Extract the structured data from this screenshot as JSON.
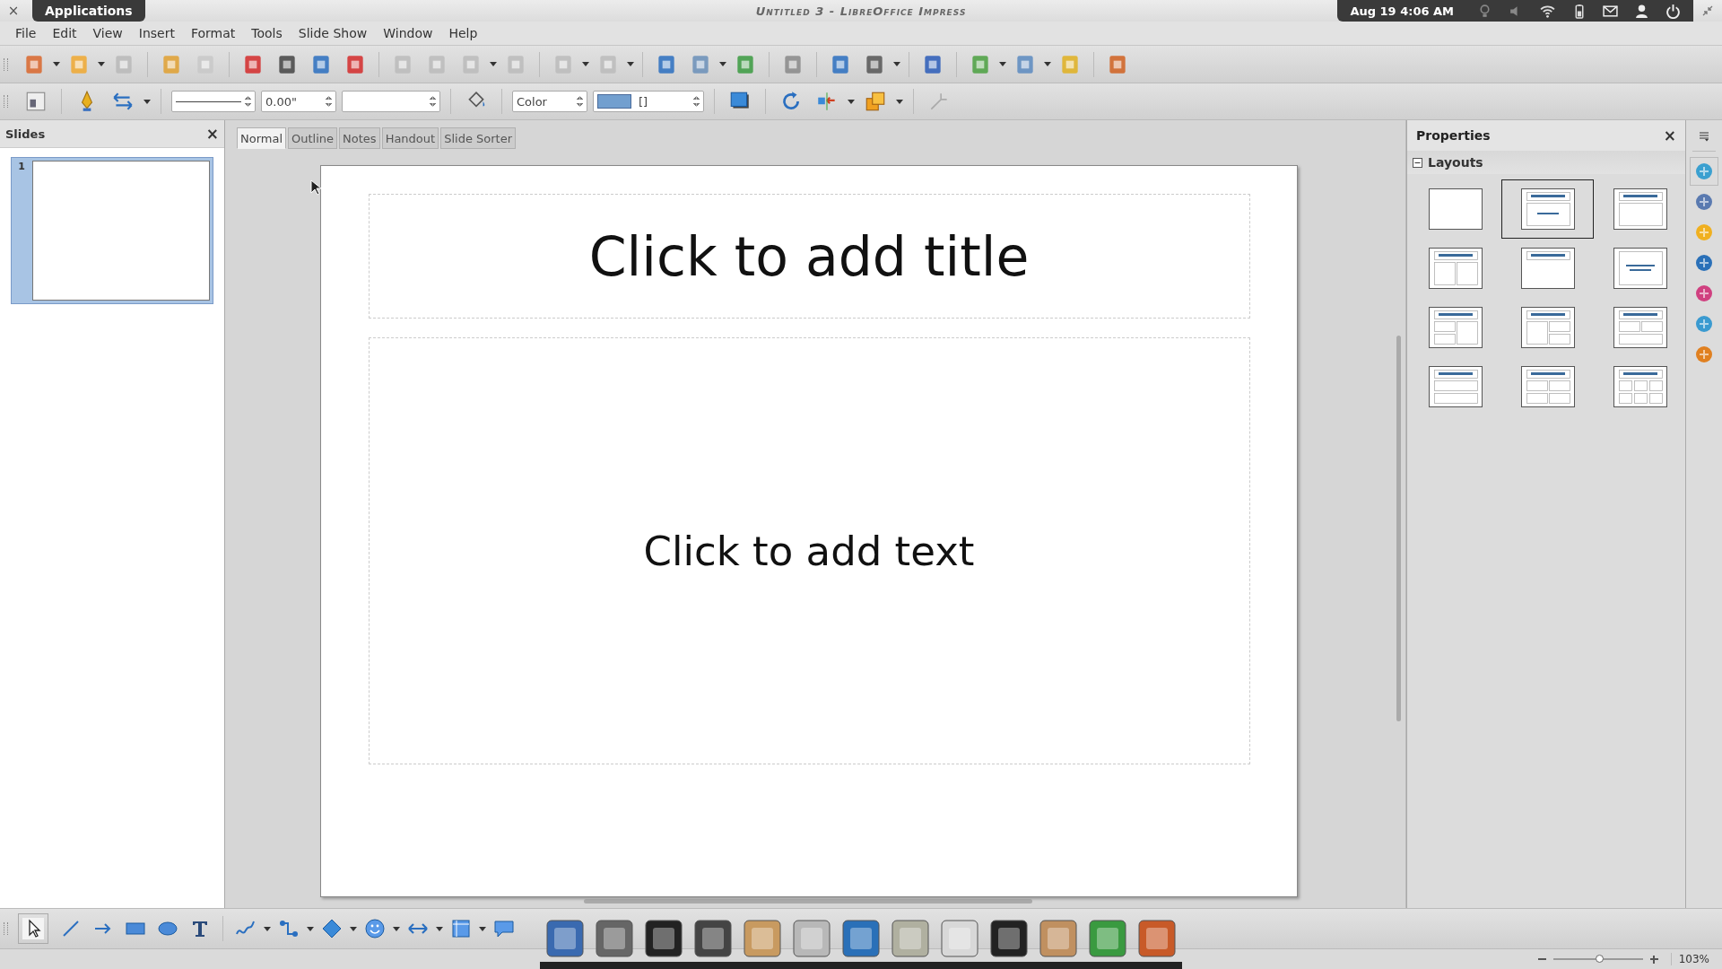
{
  "top_bar": {
    "close": "×",
    "app_tab": "Applications",
    "window_title": "Untitled 3 - LibreOffice Impress",
    "clock": "Aug 19  4:06 AM"
  },
  "menu": [
    "File",
    "Edit",
    "View",
    "Insert",
    "Format",
    "Tools",
    "Slide Show",
    "Window",
    "Help"
  ],
  "line_toolbar": {
    "line_width": "0.00\"",
    "area_style": "Color",
    "fill_color": "[]"
  },
  "slides_pane": {
    "title": "Slides",
    "close": "×",
    "slides": [
      {
        "number": "1",
        "selected": true
      }
    ]
  },
  "view_tabs": [
    {
      "label": "Normal",
      "selected": true
    },
    {
      "label": "Outline",
      "selected": false
    },
    {
      "label": "Notes",
      "selected": false
    },
    {
      "label": "Handout",
      "selected": false
    },
    {
      "label": "Slide Sorter",
      "selected": false
    }
  ],
  "slide": {
    "title_placeholder": "Click to add title",
    "content_placeholder": "Click to add text"
  },
  "sidebar": {
    "title": "Properties",
    "close": "×",
    "section": "Layouts",
    "expanded": true,
    "layouts": [
      {
        "kind": "blank",
        "selected": false
      },
      {
        "kind": "title-content",
        "selected": true
      },
      {
        "kind": "title-box",
        "selected": false
      },
      {
        "kind": "title-2col",
        "selected": false
      },
      {
        "kind": "title-only",
        "selected": false
      },
      {
        "kind": "centered-text",
        "selected": false
      },
      {
        "kind": "title-2left-1right",
        "selected": false
      },
      {
        "kind": "title-1left-2right",
        "selected": false
      },
      {
        "kind": "title-2top-1bottom",
        "selected": false
      },
      {
        "kind": "title-2rows",
        "selected": false
      },
      {
        "kind": "title-4",
        "selected": false
      },
      {
        "kind": "title-6",
        "selected": false
      }
    ]
  },
  "status_bar": {
    "zoom": "103%",
    "zoom_slider": {
      "level": 0.52
    }
  }
}
